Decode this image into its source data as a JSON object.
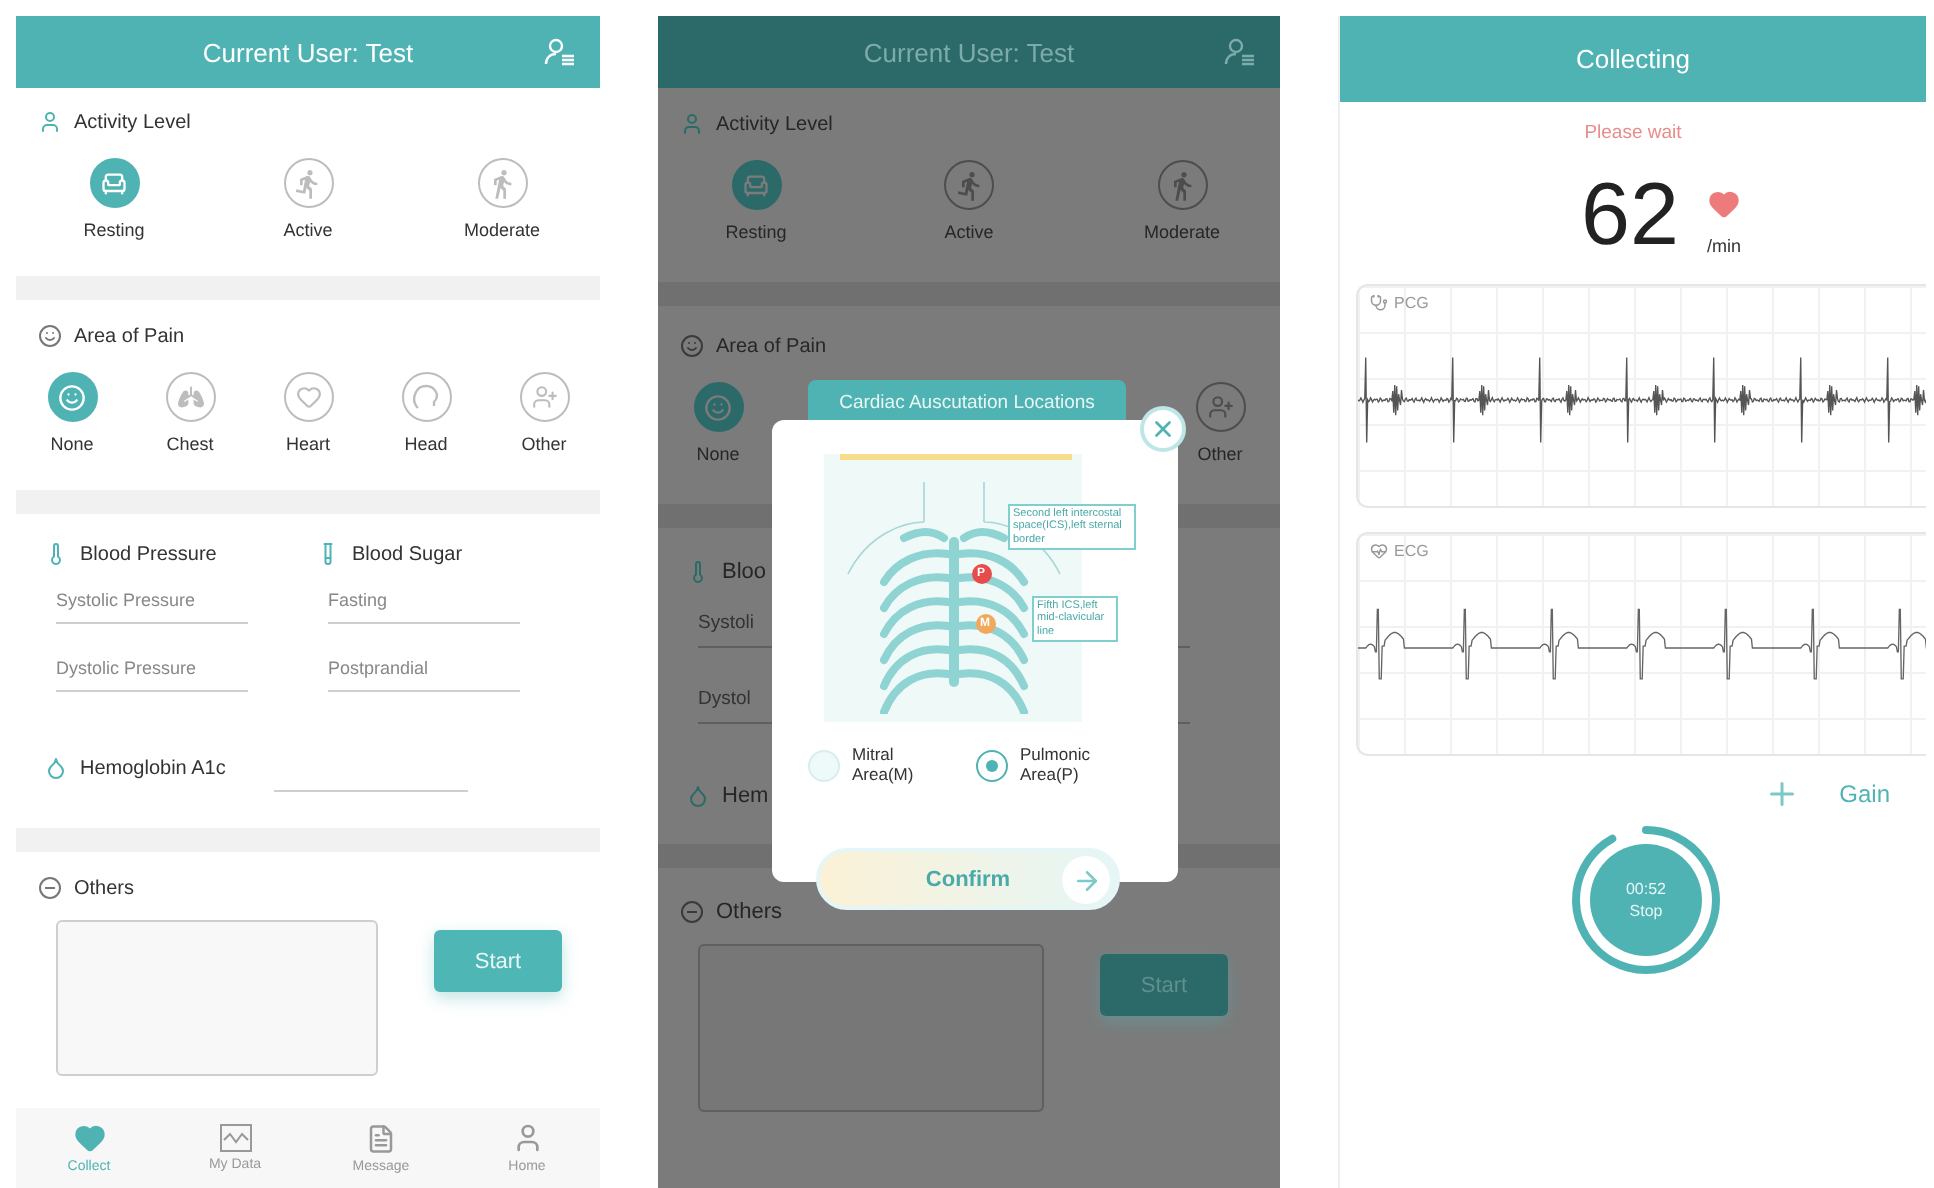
{
  "screens": [
    {
      "kind": "form",
      "dimmed": false,
      "header": {
        "title": "Current User: Test"
      },
      "activity": {
        "title": "Activity Level",
        "options": [
          {
            "label": "Resting",
            "selected": true
          },
          {
            "label": "Active",
            "selected": false
          },
          {
            "label": "Moderate",
            "selected": false
          }
        ]
      },
      "pain": {
        "title": "Area of Pain",
        "options": [
          {
            "label": "None",
            "selected": true
          },
          {
            "label": "Chest",
            "selected": false
          },
          {
            "label": "Heart",
            "selected": false
          },
          {
            "label": "Head",
            "selected": false
          },
          {
            "label": "Other",
            "selected": false
          }
        ]
      },
      "measures": {
        "columns": [
          {
            "title": "Blood Pressure",
            "fields": [
              {
                "placeholder": "Systolic Pressure"
              },
              {
                "placeholder": "Dystolic Pressure"
              }
            ]
          },
          {
            "title": "Blood Sugar",
            "fields": [
              {
                "placeholder": "Fasting"
              },
              {
                "placeholder": "Postprandial"
              }
            ]
          }
        ],
        "hemoglobin": {
          "label": "Hemoglobin A1c",
          "has_field": true
        }
      },
      "others": {
        "title": "Others",
        "button": "Start"
      },
      "tabs": [
        {
          "label": "Collect",
          "selected": true
        },
        {
          "label": "My Data",
          "selected": false
        },
        {
          "label": "Message",
          "selected": false
        },
        {
          "label": "Home",
          "selected": false
        }
      ]
    },
    {
      "kind": "form",
      "dimmed": true,
      "header": {
        "title": "Current User: Test"
      },
      "activity": {
        "title": "Activity Level",
        "options": [
          {
            "label": "Resting",
            "selected": true
          },
          {
            "label": "Active",
            "selected": false
          },
          {
            "label": "Moderate",
            "selected": false
          }
        ]
      },
      "pain": {
        "title": "Area of Pain",
        "options": [
          {
            "label": "None",
            "selected": true
          },
          {
            "label": "Other",
            "selected": false
          }
        ]
      },
      "measures": {
        "columns": [
          {
            "title": "Bloo",
            "fields": [
              {
                "placeholder": "Systoli"
              },
              {
                "placeholder": "Dystol"
              }
            ]
          }
        ],
        "hemoglobin": {
          "label": "Hem",
          "has_field": false
        }
      },
      "others": {
        "title": "Others",
        "button": "Start"
      },
      "modal": {
        "title": "Cardiac Auscutation Locations",
        "callouts": [
          {
            "text": "Second left intercostal space(ICS),left sternal border",
            "marker": "P"
          },
          {
            "text": "Fifth ICS,left mid-clavicular line",
            "marker": "M"
          }
        ],
        "options": [
          {
            "label": "Mitral Area(M)",
            "selected": false
          },
          {
            "label": "Pulmonic Area(P)",
            "selected": true
          }
        ],
        "button": "Confirm"
      }
    },
    {
      "kind": "collecting",
      "header": {
        "title": "Collecting"
      },
      "status": "Please wait",
      "rate": "62",
      "unit": "/min",
      "signals": [
        {
          "kind": "pcg",
          "label": "PCG"
        },
        {
          "kind": "ecg",
          "label": "ECG"
        }
      ],
      "gain": "Gain",
      "timer": {
        "time": "00:52",
        "action": "Stop",
        "level": 0.92
      }
    }
  ]
}
